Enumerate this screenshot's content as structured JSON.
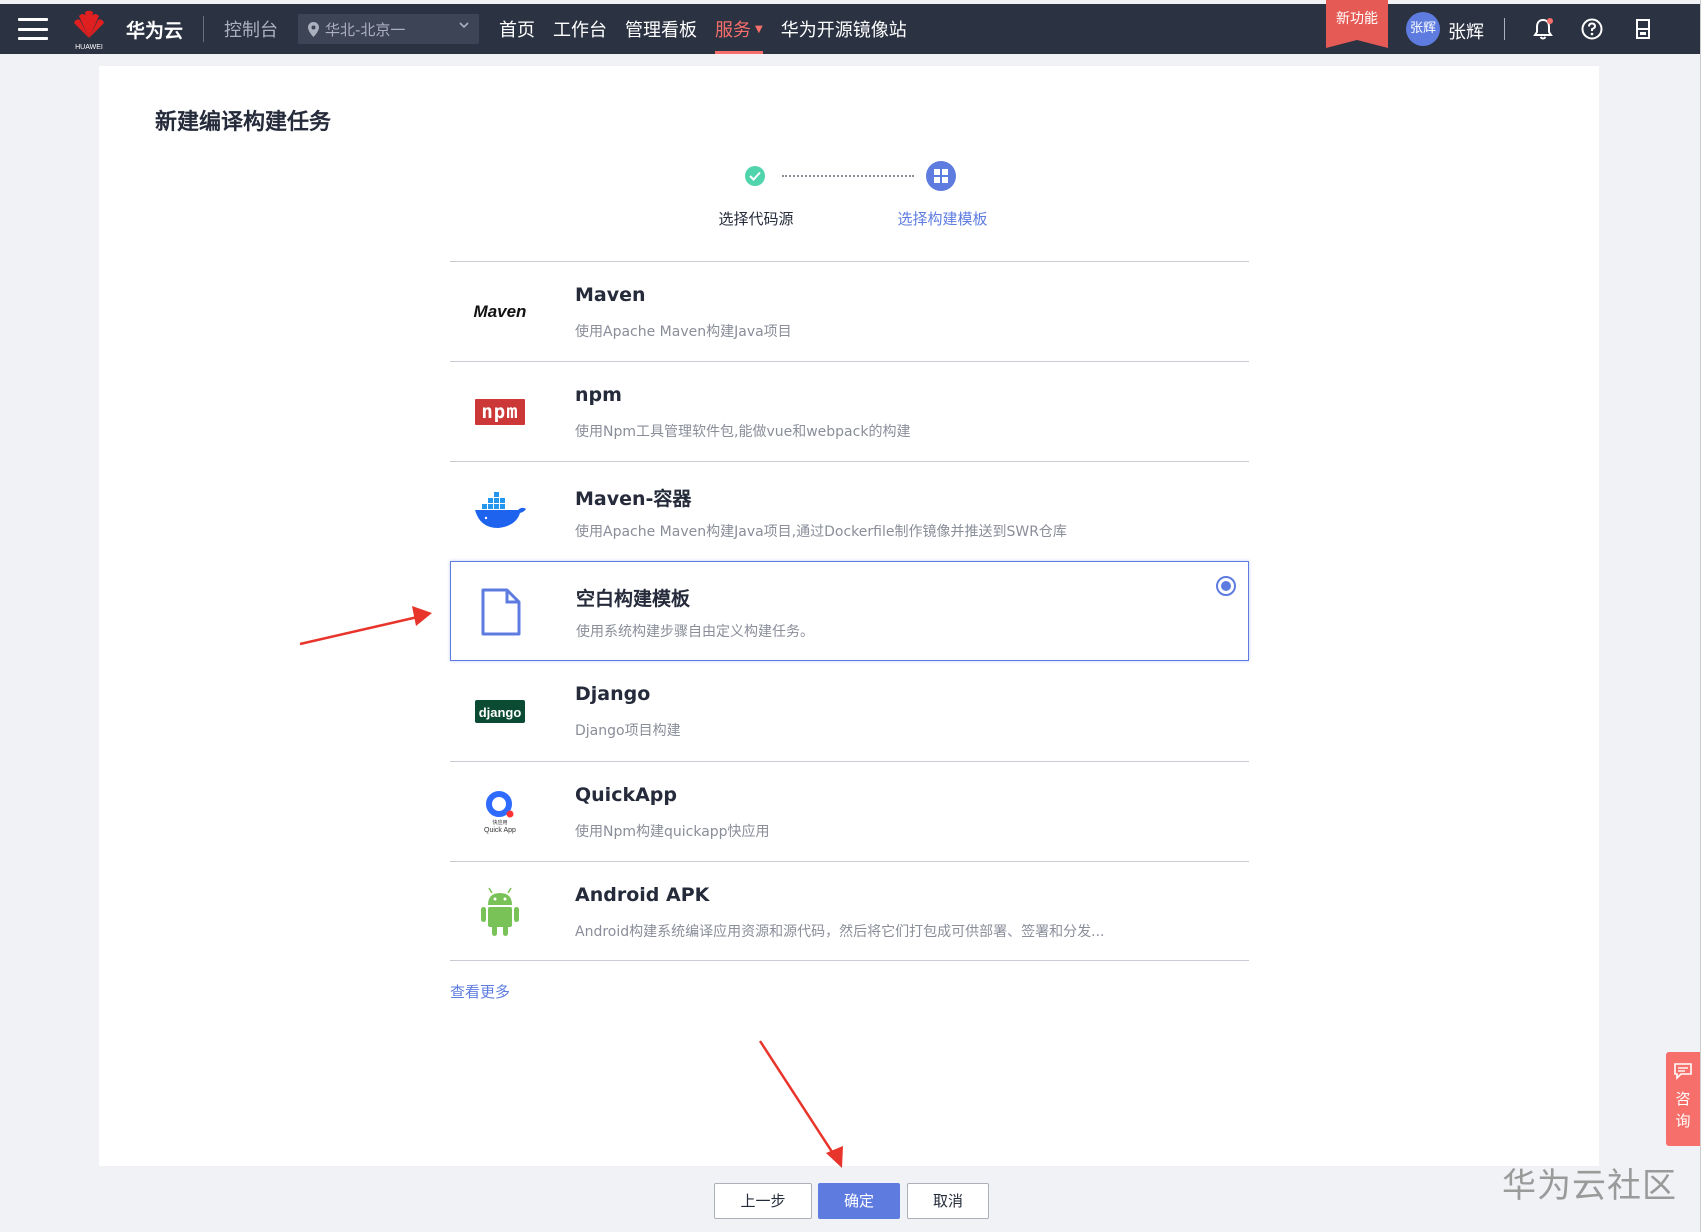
{
  "topbar": {
    "brand": "华为云",
    "console": "控制台",
    "region": "华北-北京一",
    "logo_text": "HUAWEI",
    "nav": [
      {
        "label": "首页"
      },
      {
        "label": "工作台"
      },
      {
        "label": "管理看板"
      },
      {
        "label": "服务"
      },
      {
        "label": "华为开源镜像站"
      }
    ],
    "new_feature": "新功能",
    "avatar_text": "张辉",
    "username": "张辉"
  },
  "page": {
    "title": "新建编译构建任务"
  },
  "stepper": {
    "steps": [
      {
        "label": "选择代码源",
        "status": "done"
      },
      {
        "label": "选择构建模板",
        "status": "current"
      }
    ]
  },
  "templates": [
    {
      "name": "Maven",
      "desc": "使用Apache Maven构建Java项目",
      "icon": "maven-logo-icon"
    },
    {
      "name": "npm",
      "desc": "使用Npm工具管理软件包,能做vue和webpack的构建",
      "icon": "npm-logo-icon"
    },
    {
      "name": "Maven-容器",
      "desc": "使用Apache Maven构建Java项目,通过Dockerfile制作镜像并推送到SWR仓库",
      "icon": "docker-whale-icon"
    },
    {
      "name": "空白构建模板",
      "desc": "使用系统构建步骤自由定义构建任务。",
      "icon": "blank-document-icon",
      "selected": true
    },
    {
      "name": "Django",
      "desc": "Django项目构建",
      "icon": "django-logo-icon"
    },
    {
      "name": "QuickApp",
      "desc": "使用Npm构建quickapp快应用",
      "icon": "quickapp-logo-icon"
    },
    {
      "name": "Android APK",
      "desc": "Android构建系统编译应用资源和源代码，然后将它们打包成可供部署、签署和分发...",
      "icon": "android-robot-icon"
    }
  ],
  "logo_texts": {
    "maven": "Maven",
    "npm": "npm",
    "django": "django",
    "quickapp_cn": "快应用",
    "quickapp_en": "Quick App"
  },
  "more_link": "查看更多",
  "buttons": {
    "prev": "上一步",
    "ok": "确定",
    "cancel": "取消"
  },
  "consult": {
    "line1": "咨",
    "line2": "询"
  },
  "watermark": "华为云社区",
  "colors": {
    "topbar_bg": "#2b3242",
    "accent": "#5e7ce0",
    "active_nav": "#f66f6a",
    "success": "#50d4ab",
    "annotation_arrow": "#e8352b"
  }
}
